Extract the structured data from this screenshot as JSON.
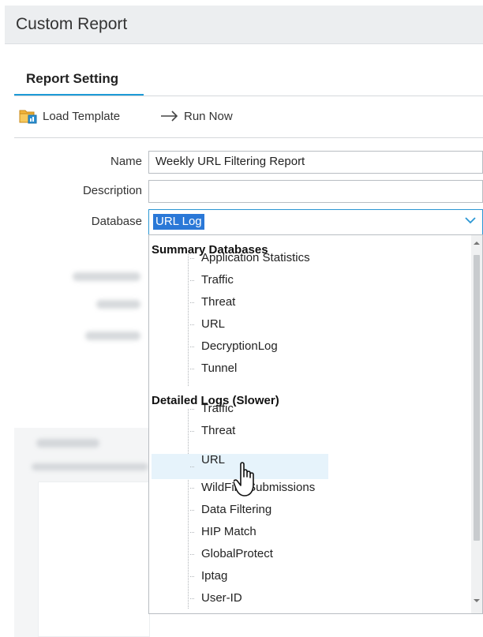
{
  "window": {
    "title": "Custom Report"
  },
  "tabs": [
    {
      "label": "Report Setting",
      "active": true
    }
  ],
  "toolbar": {
    "load_template": {
      "label": "Load Template",
      "icon": "folder-template-icon"
    },
    "run_now": {
      "label": "Run Now",
      "icon": "arrow-right-icon"
    }
  },
  "form": {
    "name": {
      "label": "Name",
      "value": "Weekly URL Filtering Report"
    },
    "description": {
      "label": "Description",
      "value": ""
    },
    "database": {
      "label": "Database",
      "value": "URL Log"
    }
  },
  "dropdown": {
    "groups": [
      {
        "label": "Summary Databases",
        "items": [
          "Application Statistics",
          "Traffic",
          "Threat",
          "URL",
          "DecryptionLog",
          "Tunnel"
        ]
      },
      {
        "label": "Detailed Logs (Slower)",
        "items": [
          "Traffic",
          "Threat",
          "URL",
          "WildFire Submissions",
          "Data Filtering",
          "HIP Match",
          "GlobalProtect",
          "Iptag",
          "User-ID"
        ]
      }
    ],
    "hovered_item": "URL"
  },
  "colors": {
    "accent": "#1e9bd7",
    "selection": "#2a78d7",
    "hover": "#e6f3fb",
    "titlebar": "#eceef0"
  }
}
